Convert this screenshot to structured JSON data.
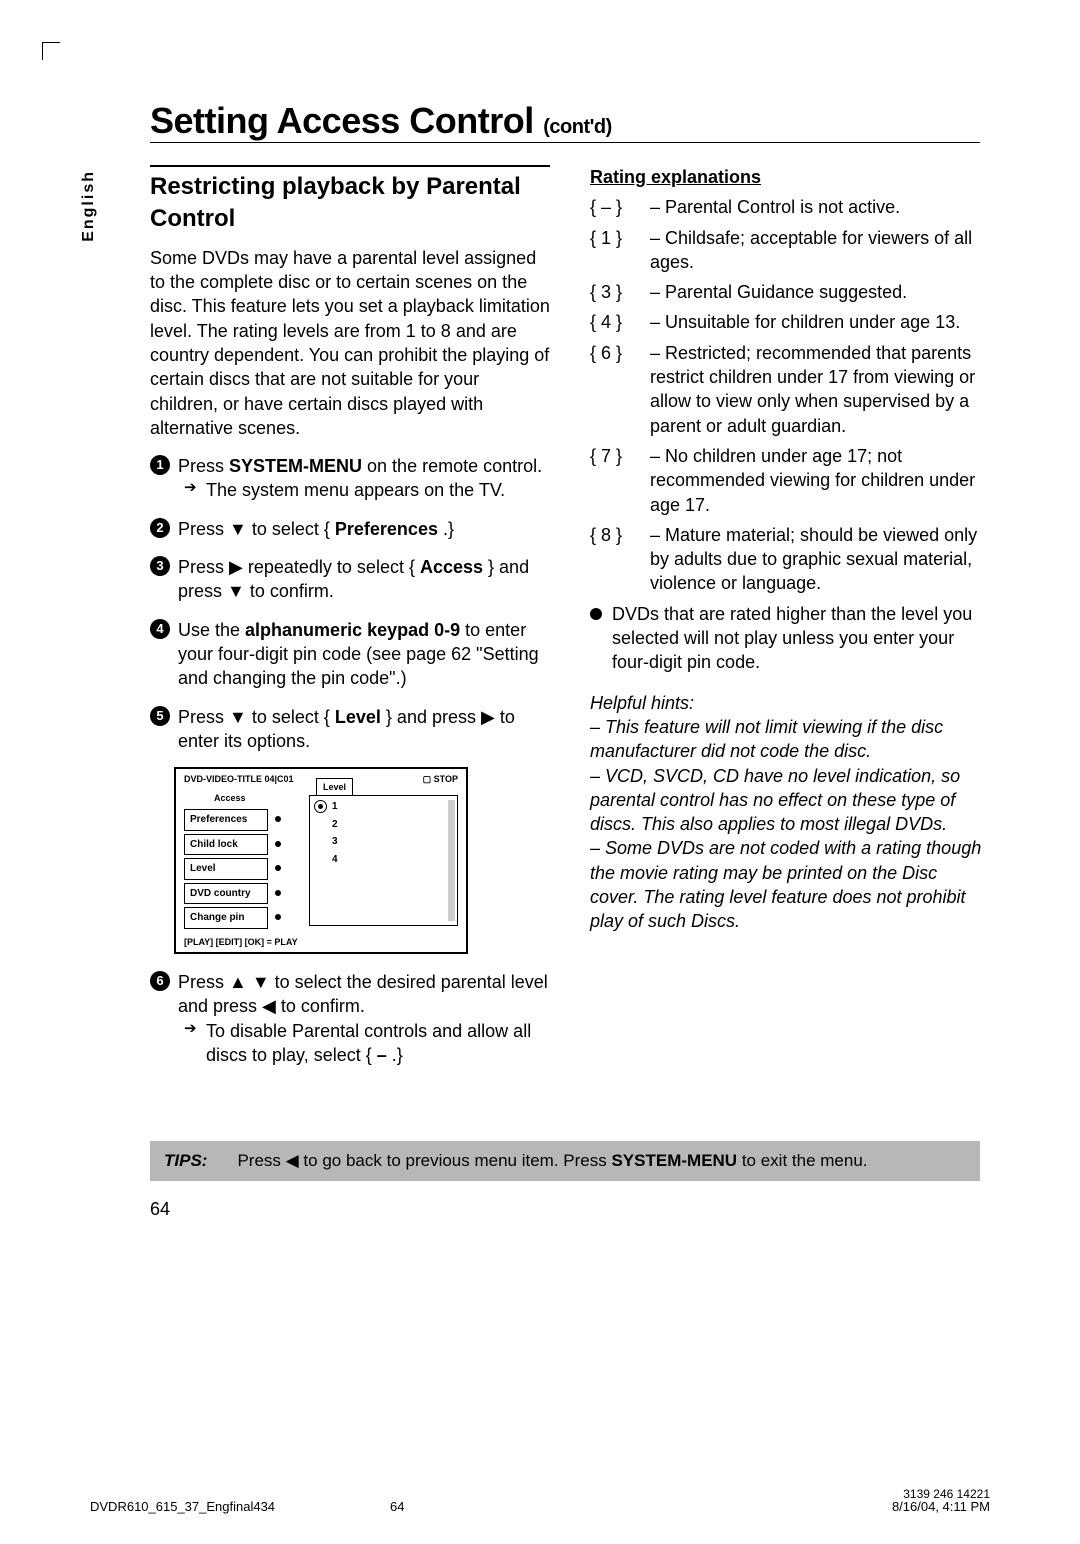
{
  "lang_tab": "English",
  "title_main": "Setting Access Control ",
  "title_contd": "(cont'd)",
  "left": {
    "subtitle": "Restricting playback by Parental Control",
    "para1": "Some DVDs may have a parental level assigned to the complete disc or to certain scenes on the disc. This feature lets you set a playback limitation level. The rating levels are from 1 to 8 and are country dependent. You can prohibit the playing of certain discs that are not suitable for your children, or have certain discs played with alternative scenes.",
    "step1_a": "Press ",
    "step1_b": "SYSTEM-MENU",
    "step1_c": " on the remote control.",
    "step1_res": "The system menu appears on the TV.",
    "step2_a": "Press ▼ to select { ",
    "step2_b": "Preferences",
    "step2_c": " .}",
    "step3_a": "Press ▶ repeatedly to select { ",
    "step3_b": "Access",
    "step3_c": " } and press ▼ to confirm.",
    "step4_a": "Use the ",
    "step4_b": "alphanumeric keypad 0-9",
    "step4_c": " to enter your four-digit pin code (see page 62 \"Setting and changing the pin code\".)",
    "step5_a": "Press ▼ to select { ",
    "step5_b": "Level",
    "step5_c": " } and press ▶ to enter its options.",
    "step6_a": "Press ▲ ▼ to select the desired parental level and press ◀ to confirm.",
    "step6_res_a": "To disable Parental controls and allow all discs to play, select { ",
    "step6_res_b": "–",
    "step6_res_c": " .}"
  },
  "osd": {
    "title": "DVD-VIDEO-TITLE 04|C01",
    "stop": "▢ STOP",
    "access": "Access",
    "pref": "Preferences",
    "childlock": "Child lock",
    "level": "Level",
    "country": "DVD country",
    "changepin": "Change pin",
    "panel_label": "Level",
    "opts": [
      "1",
      "2",
      "3",
      "4"
    ],
    "footer": "[PLAY] [EDIT] [OK] = PLAY"
  },
  "right": {
    "subsection": "Rating explanations",
    "ratings": [
      {
        "code": "{ – }",
        "desc": "– Parental Control is not active."
      },
      {
        "code": "{ 1 }",
        "desc": "– Childsafe; acceptable for viewers of all ages."
      },
      {
        "code": "{ 3 }",
        "desc": "– Parental Guidance suggested."
      },
      {
        "code": "{ 4 }",
        "desc": "– Unsuitable for children under age 13."
      },
      {
        "code": "{ 6 }",
        "desc": "– Restricted; recommended that parents restrict children under 17 from viewing or allow to view only when supervised by a parent or adult guardian."
      },
      {
        "code": "{ 7 }",
        "desc": "– No children under age 17; not recommended viewing for children under age 17."
      },
      {
        "code": "{ 8 }",
        "desc": "– Mature material; should be viewed only by adults due to graphic sexual material, violence or language."
      }
    ],
    "bullet": "DVDs that are rated higher than the level you selected will not play unless you enter your four-digit pin code.",
    "hints_title": "Helpful hints:",
    "hints": "– This feature will not limit viewing if the disc manufacturer did not code the disc.\n– VCD, SVCD, CD have no level indication, so parental control has no effect on these type of discs. This also applies to most illegal DVDs.\n– Some DVDs are not coded with a rating though the movie rating may be printed on the Disc cover. The rating level feature does not prohibit play of such Discs."
  },
  "tips": {
    "label": "TIPS:",
    "text_a": "Press ◀ to go back to previous menu item. Press ",
    "text_b": "SYSTEM-MENU",
    "text_c": " to exit the menu."
  },
  "page_number": "64",
  "footer": {
    "left": "DVDR610_615_37_Engfinal434",
    "mid": "64",
    "date": "8/16/04, 4:11 PM",
    "right": "3139 246 14221"
  }
}
